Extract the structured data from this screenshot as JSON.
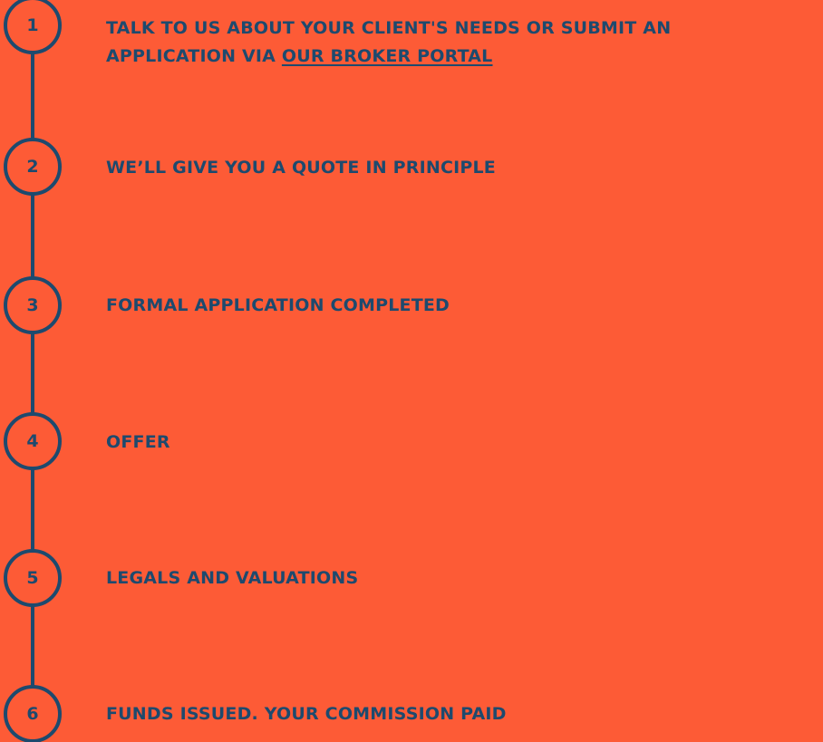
{
  "colors": {
    "background": "#FD5B36",
    "accent": "#1D4A6E"
  },
  "steps": [
    {
      "number": "1",
      "text": "TALK TO US ABOUT YOUR CLIENT'S NEEDS OR SUBMIT AN",
      "text_line2": "APPLICATION VIA ",
      "link_label": "OUR BROKER PORTAL"
    },
    {
      "number": "2",
      "text": "WE’LL GIVE YOU A QUOTE IN PRINCIPLE"
    },
    {
      "number": "3",
      "text": "FORMAL APPLICATION COMPLETED"
    },
    {
      "number": "4",
      "text": "OFFER"
    },
    {
      "number": "5",
      "text": "LEGALS AND VALUATIONS"
    },
    {
      "number": "6",
      "text": "FUNDS ISSUED. YOUR COMMISSION PAID"
    }
  ]
}
